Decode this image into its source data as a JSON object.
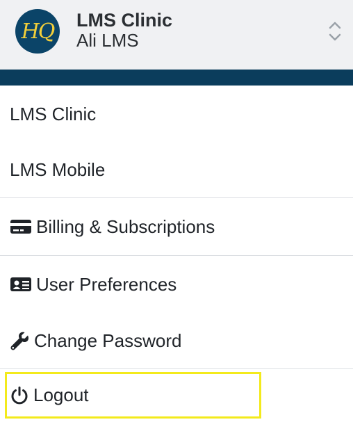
{
  "header": {
    "logo_text": "HQ",
    "org_name": "LMS Clinic",
    "user_name": "Ali LMS",
    "switch_icon": "chevron-up-down-icon"
  },
  "menu": {
    "clinics": [
      {
        "label": "LMS Clinic"
      },
      {
        "label": "LMS Mobile"
      }
    ],
    "billing": {
      "label": "Billing & Subscriptions",
      "icon": "credit-card-icon"
    },
    "preferences": {
      "label": "User Preferences",
      "icon": "id-card-icon"
    },
    "password": {
      "label": "Change Password",
      "icon": "wrench-icon"
    },
    "logout": {
      "label": "Logout",
      "icon": "power-icon"
    }
  },
  "colors": {
    "brand_navy": "#0b3d5c",
    "logo_gold": "#f2cf3a",
    "highlight": "#f3ea1c"
  }
}
